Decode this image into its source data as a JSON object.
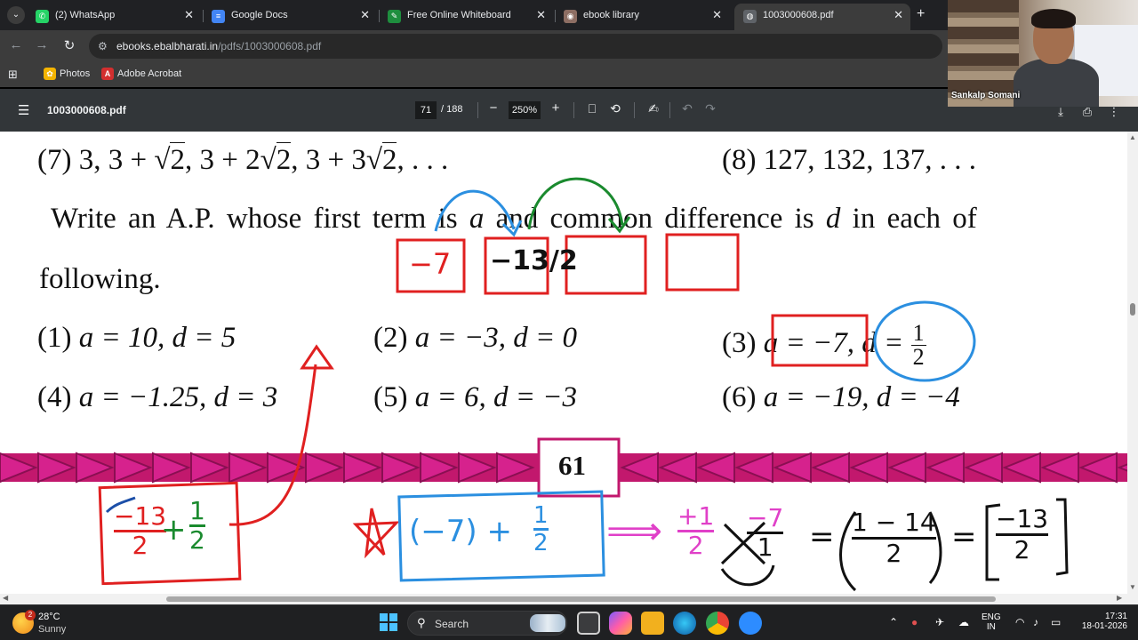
{
  "browser": {
    "tabs": [
      {
        "label": "(2) WhatsApp",
        "icon": "whatsapp-icon",
        "color": "#25d366",
        "glyph": "W"
      },
      {
        "label": "Google Docs",
        "icon": "google-docs-icon",
        "color": "#4285f4",
        "glyph": "≡"
      },
      {
        "label": "Free Online Whiteboard",
        "icon": "whiteboard-icon",
        "color": "#1e8e3e",
        "glyph": "✎"
      },
      {
        "label": "ebook library",
        "icon": "ebook-icon",
        "color": "#8d6e63",
        "glyph": "◉"
      },
      {
        "label": "1003000608.pdf",
        "icon": "globe-icon",
        "color": "#5f6368",
        "glyph": "◍"
      }
    ],
    "url_host": "ebooks.ebalbharati.in",
    "url_path": "/pdfs/1003000608.pdf",
    "bookmarks": [
      {
        "label": "Photos",
        "icon": "photos-icon",
        "color": "#ea4335",
        "glyph": "✿"
      },
      {
        "label": "Adobe Acrobat",
        "icon": "acrobat-icon",
        "color": "#d32f2f",
        "glyph": "A"
      }
    ]
  },
  "viewer": {
    "title": "1003000608.pdf",
    "page_current": "71",
    "page_total": "/ 188",
    "zoom": "250%"
  },
  "webcam": {
    "name": "Sankalp Somani"
  },
  "page": {
    "ex7_label": "(7)",
    "ex7_terms": "3, 3 + ",
    "ex7_t2": ", 3 + 2",
    "ex7_t3": ", 3 + 3",
    "ex7_end": ", . . .",
    "sqrt_symbol": "√",
    "sqrt_radicand": "2",
    "ex8": "(8) 127, 132, 137, . . .",
    "instruction_a": "Write an A.P. whose first term is",
    "instruction_var_a": "a",
    "instruction_b": "and common difference is",
    "instruction_var_d": "d",
    "instruction_c": "in each of",
    "instruction_line2": "following.",
    "q1": "(1)",
    "q1_expr": "a = 10, d = 5",
    "q2": "(2)",
    "q2_expr": "a = −3, d = 0",
    "q3": "(3)",
    "q3_a": "a = −7,",
    "q3_d": "d =",
    "q3_num": "1",
    "q3_den": "2",
    "q4": "(4)",
    "q4_expr": "a = −1.25, d = 3",
    "q5": "(5)",
    "q5_expr": "a = 6, d = −3",
    "q6": "(6)",
    "q6_expr": "a = −19, d = −4",
    "page_number": "61"
  },
  "annotations": {
    "box1": "−7",
    "box2": "−13/2",
    "work_left_num1": "−13",
    "work_left_den1": "2",
    "work_plus": "+",
    "work_left_num2": "1",
    "work_left_den2": "2",
    "work_mid": "(−7) +",
    "work_mid_num": "1",
    "work_mid_den": "2",
    "work_arrow": "⟹",
    "work_r_num1": "+1",
    "work_r_den1": "2",
    "work_r_num2": "−7",
    "work_r_den2": "1",
    "work_eq1": "=",
    "work_r_num3": "1 − 14",
    "work_r_den3": "2",
    "work_eq2": "=",
    "work_r_num4": "−13",
    "work_r_den4": "2"
  },
  "colors": {
    "ink_red": "#e02020",
    "ink_blue": "#2b8fe0",
    "ink_green": "#1a8a2e",
    "ink_pink": "#e040c8",
    "banner_magenta": "#d6228d",
    "banner_dark": "#8a0f52"
  },
  "taskbar": {
    "weather_badge": "2",
    "temperature": "28°C",
    "condition": "Sunny",
    "search_label": "Search",
    "language_1": "ENG",
    "language_2": "IN",
    "time": "17:31",
    "date": "18-01-2026"
  }
}
